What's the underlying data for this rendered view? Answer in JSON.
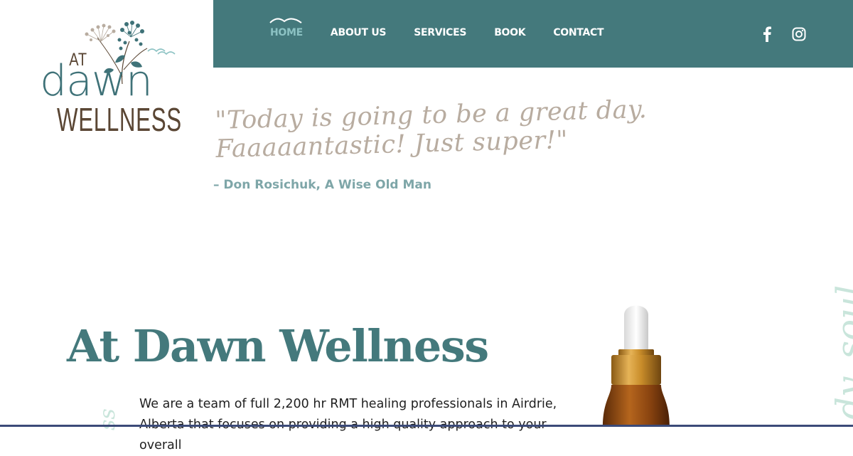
{
  "logo": {
    "line1": "AT",
    "line2": "dawn",
    "line3": "WELLNESS"
  },
  "nav": {
    "items": [
      {
        "label": "HOME",
        "active": true
      },
      {
        "label": "ABOUT US",
        "active": false
      },
      {
        "label": "SERVICES",
        "active": false
      },
      {
        "label": "BOOK",
        "active": false
      },
      {
        "label": "CONTACT",
        "active": false
      }
    ],
    "social": [
      "facebook-icon",
      "instagram-icon"
    ]
  },
  "quote": {
    "line1": "\"Today is going to be a great day.",
    "line2": "Faaaaantastic! Just super!\"",
    "author": "– Don Rosichuk, A Wise Old Man"
  },
  "main": {
    "heading": "At Dawn Wellness",
    "body": "We are a team of full 2,200 hr RMT healing professionals in Airdrie, Alberta that focuses on providing a high quality approach to your overall",
    "side_script_right": "dy. soul.",
    "side_script_left": "ss"
  },
  "colors": {
    "teal": "#44797c",
    "active_nav": "#8cc2c3",
    "quote": "#b8aca0",
    "author": "#7ea6a8",
    "logo_brown": "#5a4634"
  }
}
